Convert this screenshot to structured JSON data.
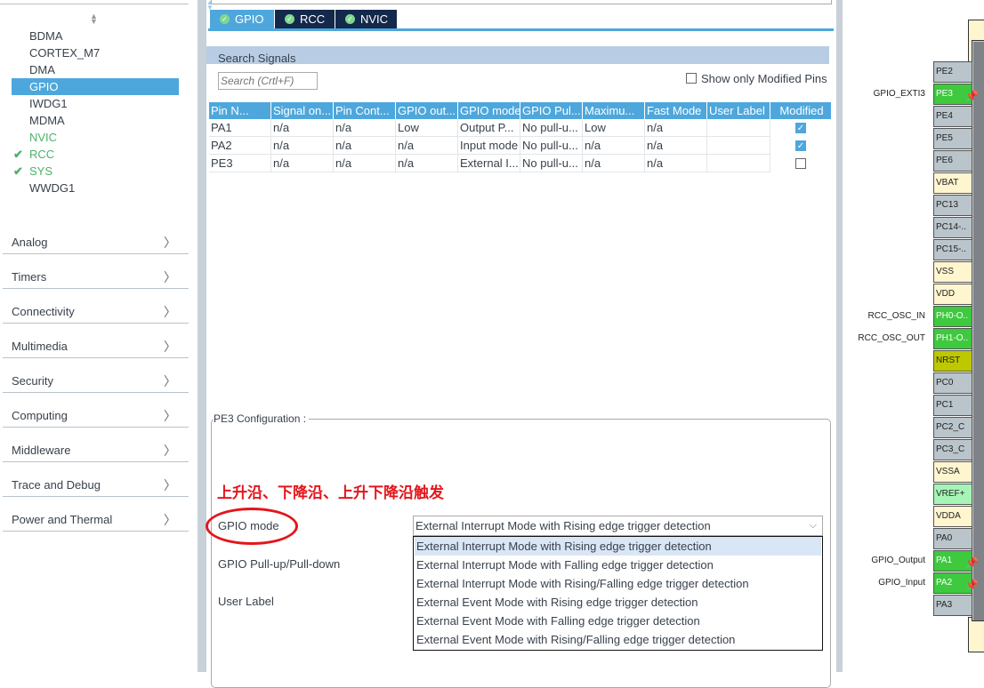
{
  "left": {
    "peripherals": [
      {
        "label": "BDMA",
        "state": "normal"
      },
      {
        "label": "CORTEX_M7",
        "state": "normal"
      },
      {
        "label": "DMA",
        "state": "normal"
      },
      {
        "label": "GPIO",
        "state": "selected"
      },
      {
        "label": "IWDG1",
        "state": "normal"
      },
      {
        "label": "MDMA",
        "state": "normal"
      },
      {
        "label": "NVIC",
        "state": "green"
      },
      {
        "label": "RCC",
        "state": "checked"
      },
      {
        "label": "SYS",
        "state": "checked"
      },
      {
        "label": "WWDG1",
        "state": "normal"
      }
    ],
    "categories": [
      "Analog",
      "Timers",
      "Connectivity",
      "Multimedia",
      "Security",
      "Computing",
      "Middleware",
      "Trace and Debug",
      "Power and Thermal"
    ]
  },
  "tabs": [
    {
      "label": "GPIO",
      "active": true
    },
    {
      "label": "RCC",
      "active": false
    },
    {
      "label": "NVIC",
      "active": false
    }
  ],
  "search": {
    "label": "Search Signals",
    "placeholder": "Search (Crtl+F)",
    "show_modified_label": "Show only Modified Pins",
    "show_modified": false
  },
  "table": {
    "columns": [
      "Pin N...",
      "Signal on...",
      "Pin Cont...",
      "GPIO out...",
      "GPIO mode",
      "GPIO Pul...",
      "Maximu...",
      "Fast Mode",
      "User Label",
      "Modified"
    ],
    "rows": [
      {
        "cells": [
          "PA1",
          "n/a",
          "n/a",
          "Low",
          "Output P...",
          "No pull-u...",
          "Low",
          "n/a",
          ""
        ],
        "modified": true,
        "selected": false
      },
      {
        "cells": [
          "PA2",
          "n/a",
          "n/a",
          "n/a",
          "Input mode",
          "No pull-u...",
          "n/a",
          "n/a",
          ""
        ],
        "modified": true,
        "selected": false
      },
      {
        "cells": [
          "PE3",
          "n/a",
          "n/a",
          "n/a",
          "External I...",
          "No pull-u...",
          "n/a",
          "n/a",
          ""
        ],
        "modified": false,
        "selected": true
      }
    ]
  },
  "config": {
    "title": "PE3 Configuration :",
    "annotation": "上升沿、下降沿、上升下降沿触发",
    "labels": [
      "GPIO mode",
      "GPIO Pull-up/Pull-down",
      "User Label"
    ],
    "gpio_mode_value": "External Interrupt Mode with Rising edge trigger detection",
    "options": [
      "External Interrupt Mode with Rising edge trigger detection",
      "External Interrupt Mode with Falling edge trigger detection",
      "External Interrupt Mode with Rising/Falling edge trigger detection",
      "External Event Mode with Rising edge trigger detection",
      "External Event Mode with Falling edge trigger detection",
      "External Event Mode with Rising/Falling edge trigger detection"
    ]
  },
  "chip": {
    "pins": [
      {
        "name": "PE2",
        "type": "io"
      },
      {
        "name": "PE3",
        "type": "used",
        "label": "GPIO_EXTI3",
        "pinned": true
      },
      {
        "name": "PE4",
        "type": "io"
      },
      {
        "name": "PE5",
        "type": "io"
      },
      {
        "name": "PE6",
        "type": "io"
      },
      {
        "name": "VBAT",
        "type": "power"
      },
      {
        "name": "PC13",
        "type": "io"
      },
      {
        "name": "PC14-..",
        "type": "io"
      },
      {
        "name": "PC15-..",
        "type": "io"
      },
      {
        "name": "VSS",
        "type": "power"
      },
      {
        "name": "VDD",
        "type": "power"
      },
      {
        "name": "PH0-O..",
        "type": "used",
        "label": "RCC_OSC_IN"
      },
      {
        "name": "PH1-O..",
        "type": "used",
        "label": "RCC_OSC_OUT"
      },
      {
        "name": "NRST",
        "type": "reset"
      },
      {
        "name": "PC0",
        "type": "io"
      },
      {
        "name": "PC1",
        "type": "io"
      },
      {
        "name": "PC2_C",
        "type": "io"
      },
      {
        "name": "PC3_C",
        "type": "io"
      },
      {
        "name": "VSSA",
        "type": "power"
      },
      {
        "name": "VREF+",
        "type": "vref"
      },
      {
        "name": "VDDA",
        "type": "power"
      },
      {
        "name": "PA0",
        "type": "io"
      },
      {
        "name": "PA1",
        "type": "used",
        "label": "GPIO_Output",
        "pinned": true
      },
      {
        "name": "PA2",
        "type": "used",
        "label": "GPIO_Input",
        "pinned": true
      },
      {
        "name": "PA3",
        "type": "io"
      }
    ],
    "colors": {
      "io": "#b9c4cb",
      "used": "#3ec93e",
      "power": "#fff5cf",
      "reset": "#bdc800",
      "vref": "#a6f5b6"
    }
  }
}
